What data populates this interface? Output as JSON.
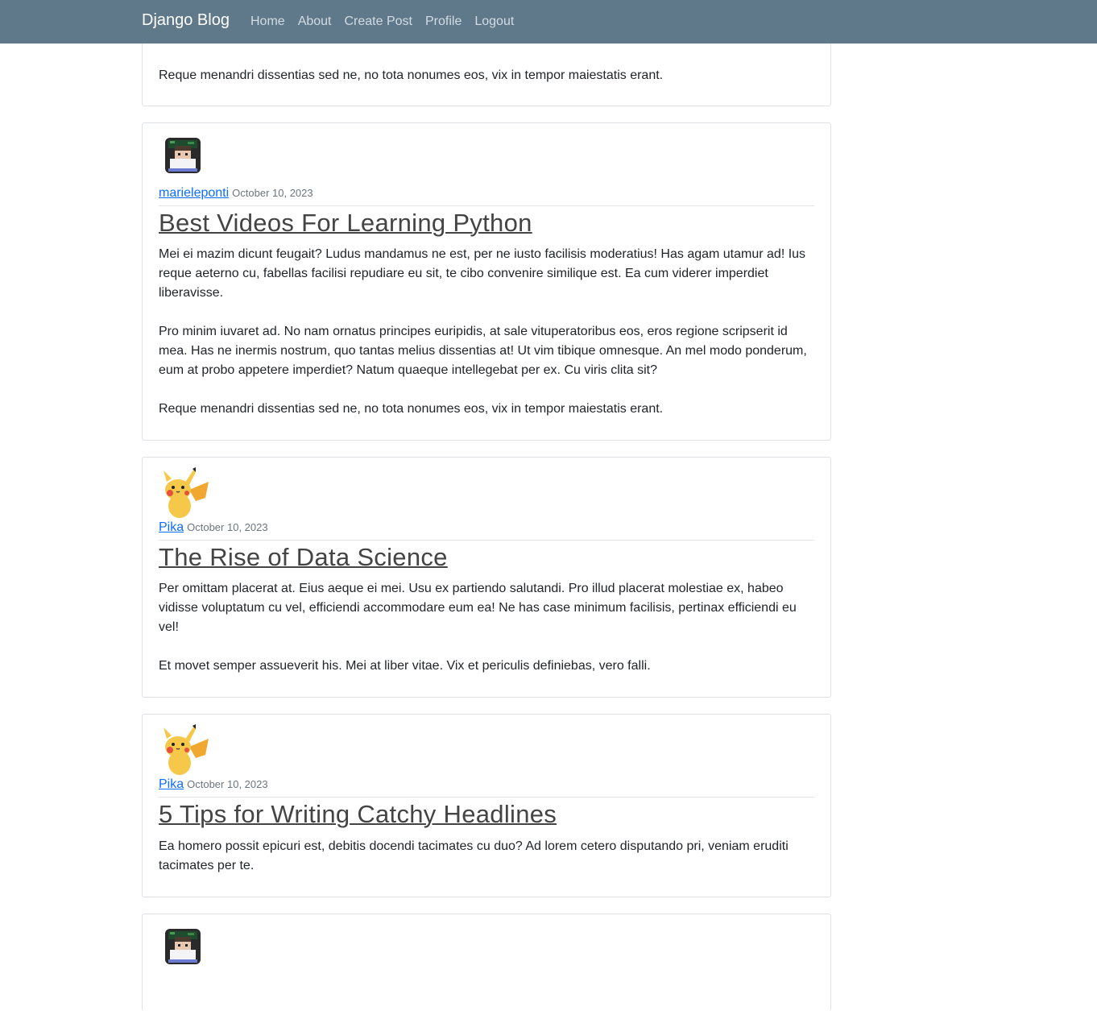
{
  "navbar": {
    "brand": "Django Blog",
    "links": [
      "Home",
      "About",
      "Create Post",
      "Profile",
      "Logout"
    ]
  },
  "partial_post": {
    "last_paragraph": "Reque menandri dissentias sed ne, no tota nonumes eos, vix in tempor maiestatis erant."
  },
  "posts": [
    {
      "author": "marieleponti",
      "date": "October 10, 2023",
      "title": "Best Videos For Learning Python",
      "paragraphs": [
        "Mei ei mazim dicunt feugait? Ludus mandamus ne est, per ne iusto facilisis moderatius! Has agam utamur ad! Ius reque aeterno cu, fabellas facilisi repudiare eu sit, te cibo convenire similique est. Ea cum viderer imperdiet liberavisse.",
        "Pro minim iuvaret ad. No nam ornatus principes euripidis, at sale vituperatoribus eos, eros regione scripserit id mea. Has ne inermis nostrum, quo tantas melius dissentias at! Ut vim tibique omnesque. An mel modo ponderum, eum at probo appetere imperdiet? Natum quaeque intellegebat per ex. Cu viris clita sit?",
        "Reque menandri dissentias sed ne, no tota nonumes eos, vix in tempor maiestatis erant."
      ]
    },
    {
      "author": "Pika",
      "date": "October 10, 2023",
      "title": "The Rise of Data Science",
      "paragraphs": [
        "Per omittam placerat at. Eius aeque ei mei. Usu ex partiendo salutandi. Pro illud placerat molestiae ex, habeo vidisse voluptatum cu vel, efficiendi accommodare eum ea! Ne has case minimum facilisis, pertinax efficiendi eu vel!",
        "Et movet semper assueverit his. Mei at liber vitae. Vix et periculis definiebas, vero falli."
      ]
    },
    {
      "author": "Pika",
      "date": "October 10, 2023",
      "title": "5 Tips for Writing Catchy Headlines",
      "paragraphs": [
        "Ea homero possit epicuri est, debitis docendi tacimates cu duo? Ad lorem cetero disputando pri, veniam eruditi tacimates per te."
      ]
    }
  ],
  "avatars": {
    "post0": "pixel-person-avatar-icon",
    "post1": "pikachu-avatar-icon",
    "post2": "pikachu-avatar-icon",
    "post3": "pixel-person-avatar-icon"
  }
}
